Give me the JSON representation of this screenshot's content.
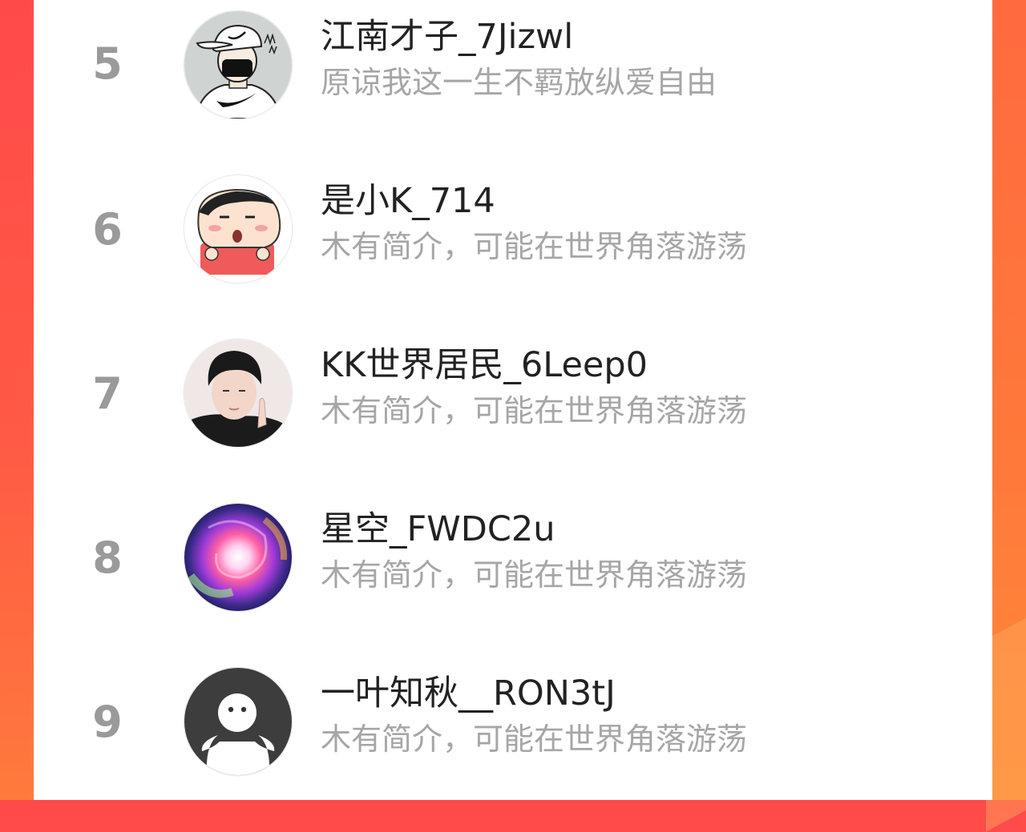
{
  "ranking": {
    "items": [
      {
        "rank": "5",
        "name": "江南才子_7Jizwl",
        "bio": "原谅我这一生不羁放纵爱自由",
        "avatar_icon": "cartoon-man-cap-icon"
      },
      {
        "rank": "6",
        "name": "是小K_714",
        "bio": "木有简介，可能在世界角落游荡",
        "avatar_icon": "crayon-boy-icon"
      },
      {
        "rank": "7",
        "name": "KK世界居民_6Leep0",
        "bio": "木有简介，可能在世界角落游荡",
        "avatar_icon": "young-man-photo-icon"
      },
      {
        "rank": "8",
        "name": "星空_FWDC2u",
        "bio": "木有简介，可能在世界角落游荡",
        "avatar_icon": "galaxy-icon"
      },
      {
        "rank": "9",
        "name": "一叶知秋__RON3tJ",
        "bio": "木有简介，可能在世界角落游荡",
        "avatar_icon": "default-ghost-avatar-icon"
      }
    ]
  },
  "colors": {
    "background_accent": "#ff4a4a",
    "rank_text": "#9a9a9a",
    "name_text": "#222222",
    "bio_text": "#a6a6a6"
  }
}
